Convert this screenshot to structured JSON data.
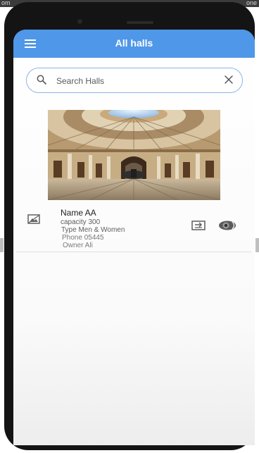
{
  "status_strip": {
    "left_text": "om",
    "right_text": "one"
  },
  "app_bar": {
    "title": "All halls",
    "background_color": "#4f97e8",
    "menu_icon": "hamburger-menu-icon"
  },
  "search": {
    "placeholder": "Search Halls",
    "value": "",
    "search_icon": "search-icon",
    "clear_icon": "close-icon"
  },
  "halls": [
    {
      "image": "domed-hall-photo",
      "thumbnail_icon": "image-icon",
      "name": "Name AA",
      "capacity": "capacity 300",
      "type": "Type Men & Women",
      "phone": "Phone 05445",
      "owner": "Owner Ali",
      "actions": [
        "screen-share-icon",
        "visibility-icon"
      ]
    }
  ]
}
